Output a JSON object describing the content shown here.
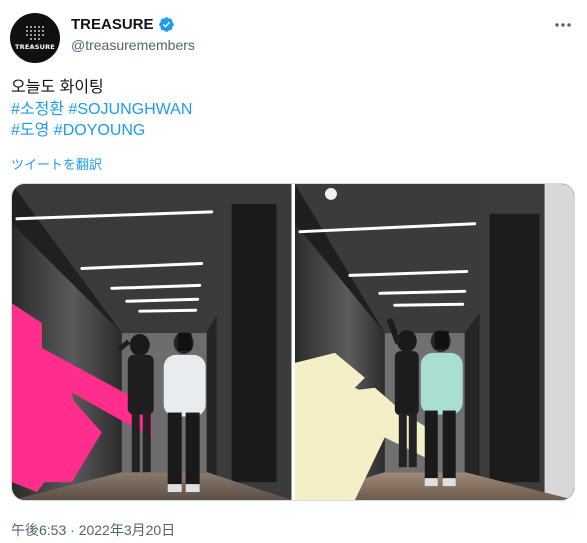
{
  "author": {
    "display_name": "TREASURE",
    "handle": "@treasuremembers",
    "avatar_wordmark": "TREASURE",
    "verified": true
  },
  "tweet": {
    "text_line1": "오늘도 화이팅",
    "hashtags": [
      "#소정환",
      "#SOJUNGHWAN",
      "#도영",
      "#DOYOUNG"
    ],
    "translate_label": "ツイートを翻訳",
    "timestamp": "午後6:53 · 2022年3月20日"
  },
  "media": {
    "count": 2,
    "photo_descriptions": [
      "mirror-selfie-hallway-pink-arrow",
      "mirror-selfie-hallway-cream-arrow"
    ]
  },
  "colors": {
    "link": "#1d9bf0",
    "text": "#0f1419",
    "secondary_text": "#536471",
    "verified_badge": "#1d9bf0",
    "border": "#cfd9de",
    "arrow_pink": "#ff2d8c",
    "arrow_cream": "#f5efc8"
  },
  "icons": {
    "verified": "verified-badge-icon",
    "more": "more-options-icon"
  }
}
